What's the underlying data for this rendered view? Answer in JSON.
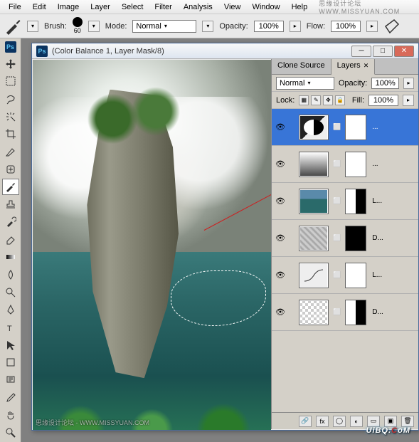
{
  "menubar": {
    "items": [
      "File",
      "Edit",
      "Image",
      "Layer",
      "Select",
      "Filter",
      "Analysis",
      "View",
      "Window",
      "Help"
    ],
    "watermark": "思缘设计论坛 WWW.MISSYUAN.COM"
  },
  "optbar": {
    "brush_label": "Brush:",
    "brush_size": "60",
    "mode_label": "Mode:",
    "mode_value": "Normal",
    "opacity_label": "Opacity:",
    "opacity_value": "100%",
    "flow_label": "Flow:",
    "flow_value": "100%"
  },
  "doc": {
    "title": "(Color Balance 1, Layer Mask/8)",
    "canvas_wm": "思缘设计论坛 - WWW.MISSYUAN.COM"
  },
  "panel": {
    "tabs": [
      "Clone Source",
      "Layers"
    ],
    "active_tab": "Layers",
    "blend_mode": "Normal",
    "opacity_label": "Opacity:",
    "opacity_value": "100%",
    "lock_label": "Lock:",
    "fill_label": "Fill:",
    "fill_value": "100%",
    "layers": [
      {
        "name": "...",
        "sel": true,
        "thumb": "adj",
        "mask": "white"
      },
      {
        "name": "...",
        "thumb": "grad",
        "mask": "white"
      },
      {
        "name": "L...",
        "thumb": "img",
        "mask": "partial"
      },
      {
        "name": "D...",
        "thumb": "tex",
        "mask": "black"
      },
      {
        "name": "L...",
        "thumb": "curves",
        "mask": "white"
      },
      {
        "name": "D...",
        "thumb": "checker",
        "mask": "partial"
      }
    ]
  },
  "watermark_bottom": "UiBQ.CoM"
}
